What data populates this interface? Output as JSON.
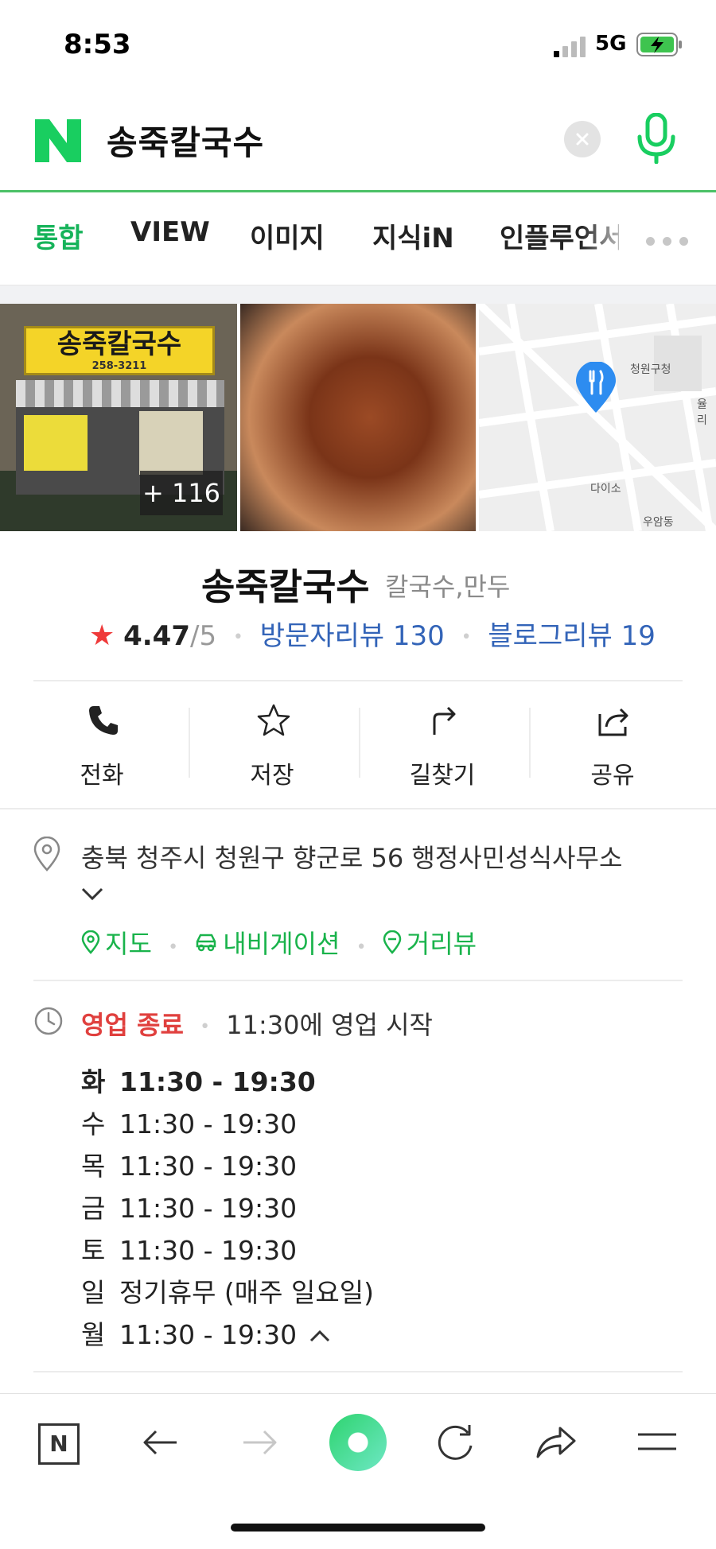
{
  "status_bar": {
    "time": "8:53",
    "network": "5G"
  },
  "search": {
    "query": "송죽칼국수"
  },
  "tabs": [
    {
      "label": "통합",
      "active": true
    },
    {
      "label": "VIEW",
      "active": false
    },
    {
      "label": "이미지",
      "active": false
    },
    {
      "label": "지식iN",
      "active": false
    },
    {
      "label": "인플루언서",
      "active": false
    }
  ],
  "photos": {
    "more_count": "+ 116",
    "sign_text": "송죽칼국수",
    "sign_phone": "258-3211",
    "map_labels": [
      "청원구청",
      "다이소",
      "우암동",
      "율리"
    ]
  },
  "place": {
    "name": "송죽칼국수",
    "category": "칼국수,만두",
    "rating": "4.47",
    "rating_max": "/5",
    "visitor_reviews": "방문자리뷰 130",
    "blog_reviews": "블로그리뷰 19"
  },
  "actions": [
    {
      "label": "전화",
      "icon": "phone-icon"
    },
    {
      "label": "저장",
      "icon": "star-outline-icon"
    },
    {
      "label": "길찾기",
      "icon": "directions-icon"
    },
    {
      "label": "공유",
      "icon": "share-icon"
    }
  ],
  "address": {
    "text": "충북 청주시 청원구 향군로 56 행정사민성식사무소",
    "links": [
      "지도",
      "내비게이션",
      "거리뷰"
    ]
  },
  "hours": {
    "status": "영업 종료",
    "next_open": "11:30에 영업 시작",
    "rows": [
      {
        "day": "화",
        "time": "11:30 - 19:30",
        "today": true
      },
      {
        "day": "수",
        "time": "11:30 - 19:30"
      },
      {
        "day": "목",
        "time": "11:30 - 19:30"
      },
      {
        "day": "금",
        "time": "11:30 - 19:30"
      },
      {
        "day": "토",
        "time": "11:30 - 19:30"
      },
      {
        "day": "일",
        "time": "정기휴무 (매주 일요일)"
      },
      {
        "day": "월",
        "time": "11:30 - 19:30"
      }
    ]
  },
  "toolbar": {
    "home_label": "N"
  },
  "colors": {
    "brand_green": "#16b35a",
    "closed_red": "#e0403e",
    "link_blue": "#3364b8"
  }
}
